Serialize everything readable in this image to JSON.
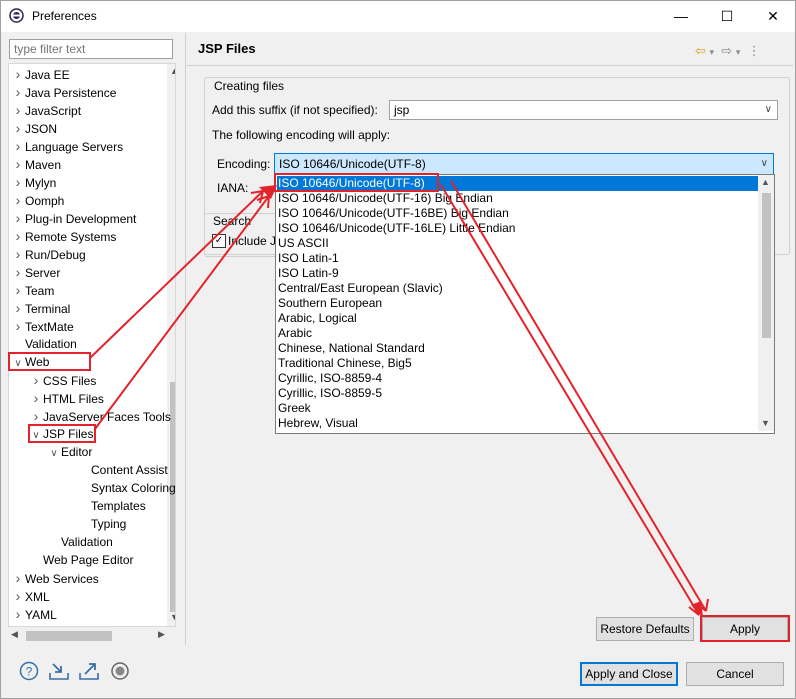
{
  "window": {
    "title": "Preferences",
    "minimize_glyph": "—",
    "maximize_glyph": "☐",
    "close_glyph": "✕"
  },
  "filter": {
    "placeholder": "type filter text"
  },
  "tree": {
    "items": [
      {
        "label": "Java EE",
        "level": 0,
        "arrow": ">"
      },
      {
        "label": "Java Persistence",
        "level": 0,
        "arrow": ">"
      },
      {
        "label": "JavaScript",
        "level": 0,
        "arrow": ">"
      },
      {
        "label": "JSON",
        "level": 0,
        "arrow": ">"
      },
      {
        "label": "Language Servers",
        "level": 0,
        "arrow": ">"
      },
      {
        "label": "Maven",
        "level": 0,
        "arrow": ">"
      },
      {
        "label": "Mylyn",
        "level": 0,
        "arrow": ">"
      },
      {
        "label": "Oomph",
        "level": 0,
        "arrow": ">"
      },
      {
        "label": "Plug-in Development",
        "level": 0,
        "arrow": ">"
      },
      {
        "label": "Remote Systems",
        "level": 0,
        "arrow": ">"
      },
      {
        "label": "Run/Debug",
        "level": 0,
        "arrow": ">"
      },
      {
        "label": "Server",
        "level": 0,
        "arrow": ">"
      },
      {
        "label": "Team",
        "level": 0,
        "arrow": ">"
      },
      {
        "label": "Terminal",
        "level": 0,
        "arrow": ">"
      },
      {
        "label": "TextMate",
        "level": 0,
        "arrow": ">"
      },
      {
        "label": "Validation",
        "level": 0,
        "arrow": ""
      },
      {
        "label": "Web",
        "level": 0,
        "arrow": "v"
      },
      {
        "label": "CSS Files",
        "level": 1,
        "arrow": ">"
      },
      {
        "label": "HTML Files",
        "level": 1,
        "arrow": ">"
      },
      {
        "label": "JavaServer Faces Tools",
        "level": 1,
        "arrow": ">"
      },
      {
        "label": "JSP Files",
        "level": 1,
        "arrow": "v"
      },
      {
        "label": "Editor",
        "level": 2,
        "arrow": "v"
      },
      {
        "label": "Content Assist",
        "level": 3,
        "arrow": ""
      },
      {
        "label": "Syntax Coloring",
        "level": 3,
        "arrow": ""
      },
      {
        "label": "Templates",
        "level": 3,
        "arrow": ""
      },
      {
        "label": "Typing",
        "level": 3,
        "arrow": ""
      },
      {
        "label": "Validation",
        "level": 2,
        "arrow": ""
      },
      {
        "label": "Web Page Editor",
        "level": 1,
        "arrow": ""
      },
      {
        "label": "Web Services",
        "level": 0,
        "arrow": ">"
      },
      {
        "label": "XML",
        "level": 0,
        "arrow": ">"
      },
      {
        "label": "YAML",
        "level": 0,
        "arrow": ">"
      }
    ]
  },
  "page": {
    "title": "JSP Files",
    "creating_files_label": "Creating files",
    "suffix_label": "Add this suffix (if not specified):",
    "suffix_value": "jsp",
    "encoding_note": "The following encoding will apply:",
    "encoding_label": "Encoding:",
    "encoding_value": "ISO 10646/Unicode(UTF-8)",
    "iana_label": "IANA:",
    "search_label": "Search",
    "include_label": "Include J"
  },
  "encoding_options": [
    "ISO 10646/Unicode(UTF-8)",
    "ISO 10646/Unicode(UTF-16) Big Endian",
    "ISO 10646/Unicode(UTF-16BE) Big Endian",
    "ISO 10646/Unicode(UTF-16LE) Little Endian",
    "US ASCII",
    "ISO Latin-1",
    "ISO Latin-9",
    "Central/East European (Slavic)",
    "Southern European",
    "Arabic, Logical",
    "Arabic",
    "Chinese, National Standard",
    "Traditional Chinese, Big5",
    "Cyrillic, ISO-8859-4",
    "Cyrillic, ISO-8859-5",
    "Greek",
    "Hebrew, Visual"
  ],
  "buttons": {
    "restore_defaults": "Restore Defaults",
    "apply": "Apply",
    "apply_and_close": "Apply and Close",
    "cancel": "Cancel"
  },
  "icons": {
    "help": "?",
    "import": "⇩",
    "export": "⇧",
    "record": "◉",
    "back": "⇦",
    "forward": "⇨",
    "menu": "⋮",
    "chevron_down": "▾"
  },
  "annotation_color": "#e3232b",
  "accent_color": "#0078d7"
}
